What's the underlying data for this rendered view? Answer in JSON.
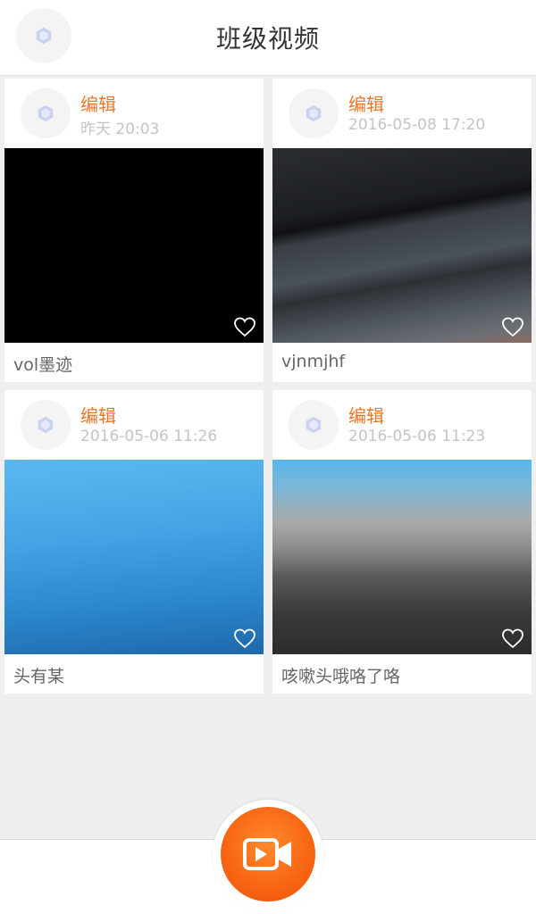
{
  "header": {
    "title": "班级视频",
    "avatar_icon": "hexagon-logo-icon"
  },
  "videos": [
    {
      "action": "编辑",
      "date": "昨天 20:03",
      "caption": "vol墨迹",
      "thumbnail": "black-frame",
      "like_icon": "heart-outline-icon"
    },
    {
      "action": "编辑",
      "date": "2016-05-08 17:20",
      "caption": "vjnmjhf",
      "thumbnail": "dark-keyboard-frame",
      "like_icon": "heart-outline-icon"
    },
    {
      "action": "编辑",
      "date": "2016-05-06 11:26",
      "caption": "头有某",
      "thumbnail": "blue-frame",
      "like_icon": "heart-outline-icon"
    },
    {
      "action": "编辑",
      "date": "2016-05-06 11:23",
      "caption": "咳嗽头哦咯了咯",
      "thumbnail": "blue-gray-frame",
      "like_icon": "heart-outline-icon"
    }
  ],
  "footer": {
    "record_icon": "video-camera-icon"
  },
  "colors": {
    "accent": "#e8772a",
    "date": "#c4c4c4",
    "background": "#efefef",
    "record_button": "#f86412"
  }
}
